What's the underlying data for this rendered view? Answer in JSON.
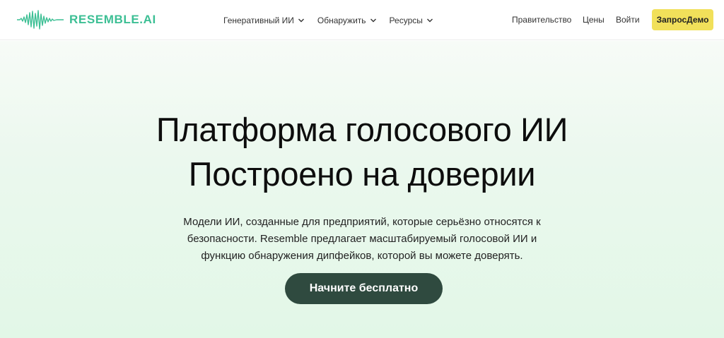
{
  "brand": {
    "name": "RESEMBLE.AI",
    "color": "#3cbf94"
  },
  "nav": {
    "items": [
      {
        "label": "Генеративный ИИ",
        "icon": "chevron-down-icon"
      },
      {
        "label": "Обнаружить",
        "icon": "chevron-down-icon"
      },
      {
        "label": "Ресурсы",
        "icon": "chevron-down-icon"
      }
    ],
    "government": "Правительство",
    "pricing": "Цены",
    "login": "Войти",
    "demo": "ЗапросДемо"
  },
  "hero": {
    "title_line1": "Платформа голосового ИИ",
    "title_line2": "Построено на доверии",
    "subtitle_line1": "Модели ИИ, созданные для предприятий, которые серьёзно относятся к",
    "subtitle_line2": "безопасности. Resemble предлагает масштабируемый голосовой ИИ и",
    "subtitle_line3": "функцию обнаружения дипфейков, которой вы можете доверять.",
    "cta": "Начните бесплатно"
  },
  "colors": {
    "demo_button": "#f1e05a",
    "cta_button": "#2f4a3f",
    "hero_background": "#e2f7e7"
  }
}
